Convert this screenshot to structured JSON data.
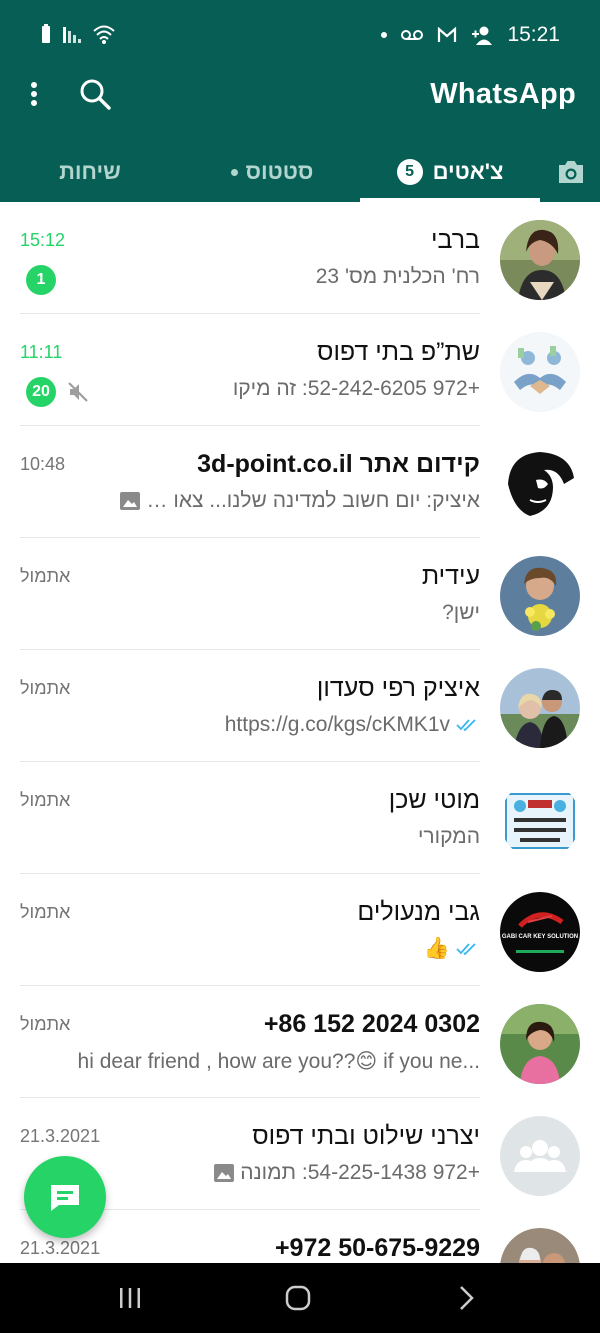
{
  "status_bar": {
    "time": "15:21",
    "left_icons": [
      "battery-icon",
      "signal-icon",
      "wifi-icon"
    ],
    "right_icons": [
      "notification-dot-icon",
      "voicemail-icon",
      "gmail-icon",
      "add-person-icon"
    ]
  },
  "app_bar": {
    "title": "WhatsApp",
    "tabs": [
      {
        "label": "שיחות",
        "id": "calls"
      },
      {
        "label": "סטטוס",
        "id": "status"
      },
      {
        "label": "צ'אטים",
        "id": "chats",
        "badge": "5",
        "active": true
      }
    ]
  },
  "colors": {
    "header": "#075e54",
    "accent": "#25d366",
    "tick_blue": "#34b7f1"
  },
  "chats": [
    {
      "name": "ברבי",
      "preview": "רח' הכלנית מס' 23",
      "time": "15:12",
      "unread": "1",
      "avatar": "woman-photo"
    },
    {
      "name": "שת”פ בתי דפוס",
      "preview": "+972 52-242-6205: זה מיקו",
      "time": "11:11",
      "unread": "20",
      "muted": true,
      "avatar": "handshake-photo"
    },
    {
      "name": "קידום אתר 3d-point.co.il",
      "preview": "איציק: יום חשוב למדינה שלנו... צאו לבחו...",
      "time": "10:48",
      "has_image_icon": true,
      "avatar": "face-sketch-photo"
    },
    {
      "name": "עידית",
      "preview": "ישן?",
      "time": "אתמול",
      "avatar": "flowers-photo"
    },
    {
      "name": "איציק רפי סעדון",
      "preview": "https://g.co/kgs/cKMK1v",
      "time": "אתמול",
      "read_ticks": true,
      "avatar": "couple-photo"
    },
    {
      "name": "מוטי שכן",
      "preview": "המקורי",
      "time": "אתמול",
      "avatar": "greeting-card-photo"
    },
    {
      "name": "גבי מנעולים",
      "preview": "👍",
      "time": "אתמול",
      "read_ticks": true,
      "avatar": "car-key-logo",
      "avatar_text": "GABI CAR KEY SOLUTION"
    },
    {
      "name": "+86 152 2024 0302",
      "preview": "hi dear friend , how are you??😊 if you ne...",
      "time": "אתמול",
      "avatar": "girl-photo"
    },
    {
      "name": "יצרני שילוט ובתי דפוס",
      "preview": "+972 54-225-1438: תמונה",
      "time": "21.3.2021",
      "has_image_icon": true,
      "avatar": "group-icon"
    },
    {
      "name": "+972 50-675-9229",
      "preview": "",
      "time": "21.3.2021",
      "avatar": "people-photo"
    }
  ],
  "fab_icon": "new-chat-icon",
  "nav_bar": {
    "buttons": [
      "recent-apps-icon",
      "home-icon",
      "back-icon"
    ]
  }
}
